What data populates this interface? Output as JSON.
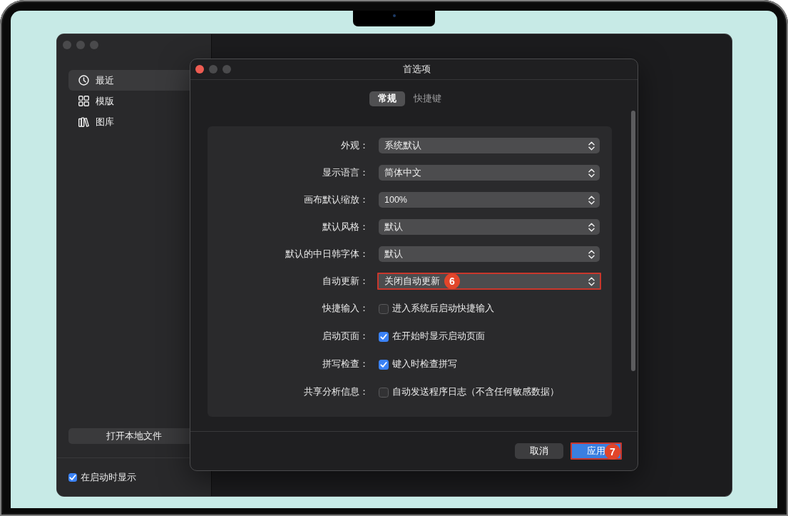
{
  "sidebar": {
    "items": [
      {
        "label": "最近",
        "selected": true
      },
      {
        "label": "模版",
        "selected": false
      },
      {
        "label": "图库",
        "selected": false
      }
    ],
    "open_file_button": "打开本地文件",
    "show_on_startup": {
      "label": "在启动时显示",
      "checked": true
    }
  },
  "dialog": {
    "title": "首选项",
    "tabs": [
      {
        "label": "常规",
        "selected": true
      },
      {
        "label": "快捷键",
        "selected": false
      }
    ],
    "settings": [
      {
        "kind": "select",
        "label": "外观：",
        "value": "系统默认",
        "highlighted": false
      },
      {
        "kind": "select",
        "label": "显示语言：",
        "value": "简体中文",
        "highlighted": false
      },
      {
        "kind": "select",
        "label": "画布默认缩放：",
        "value": "100%",
        "highlighted": false
      },
      {
        "kind": "select",
        "label": "默认风格：",
        "value": "默认",
        "highlighted": false
      },
      {
        "kind": "select",
        "label": "默认的中日韩字体：",
        "value": "默认",
        "highlighted": false
      },
      {
        "kind": "select",
        "label": "自动更新：",
        "value": "关闭自动更新",
        "highlighted": true,
        "step_badge": "6"
      },
      {
        "kind": "checkbox",
        "label": "快捷输入：",
        "text": "进入系统后启动快捷输入",
        "checked": false
      },
      {
        "kind": "checkbox",
        "label": "启动页面：",
        "text": "在开始时显示启动页面",
        "checked": true
      },
      {
        "kind": "checkbox",
        "label": "拼写检查：",
        "text": "键入时检查拼写",
        "checked": true
      },
      {
        "kind": "checkbox",
        "label": "共享分析信息：",
        "text": "自动发送程序日志（不含任何敏感数据）",
        "checked": false
      }
    ],
    "buttons": [
      {
        "label": "取消",
        "kind": "secondary",
        "highlighted": false
      },
      {
        "label": "应用",
        "kind": "primary",
        "highlighted": true,
        "step_badge": "7"
      }
    ]
  }
}
